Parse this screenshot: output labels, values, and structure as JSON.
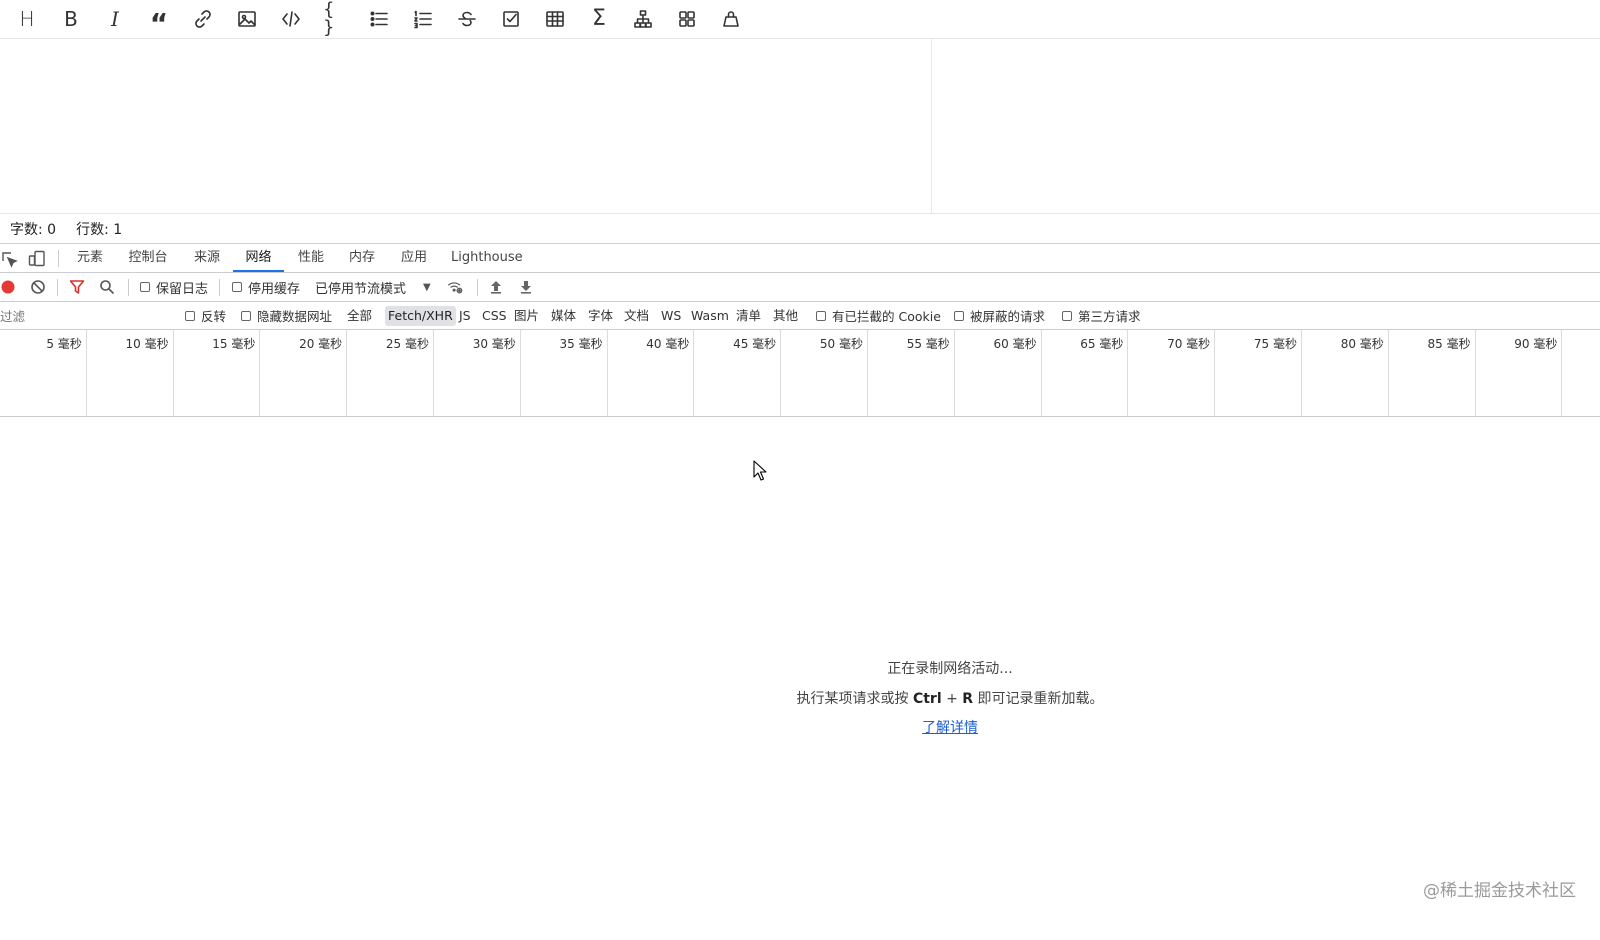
{
  "editor_toolbar": {
    "tools": [
      {
        "icon": "heading-icon",
        "glyph": "H"
      },
      {
        "icon": "bold-icon",
        "glyph": "B"
      },
      {
        "icon": "italic-icon",
        "glyph": "I"
      },
      {
        "icon": "quote-icon",
        "glyph": "“"
      },
      {
        "icon": "link-icon"
      },
      {
        "icon": "image-icon"
      },
      {
        "icon": "code-icon"
      },
      {
        "icon": "code-block-icon",
        "glyph": "{ }"
      },
      {
        "icon": "unordered-list-icon"
      },
      {
        "icon": "ordered-list-icon"
      },
      {
        "icon": "strikethrough-icon"
      },
      {
        "icon": "task-list-icon"
      },
      {
        "icon": "table-icon"
      },
      {
        "icon": "formula-icon",
        "glyph": "Σ"
      },
      {
        "icon": "mermaid-diagram-icon"
      },
      {
        "icon": "grid-icon"
      },
      {
        "icon": "clear-icon"
      }
    ]
  },
  "statusbar": {
    "word_count": "字数: 0",
    "line_count": "行数: 1"
  },
  "devtools": {
    "tabs": [
      "元素",
      "控制台",
      "来源",
      "网络",
      "性能",
      "内存",
      "应用",
      "Lighthouse"
    ],
    "active_tab": "网络"
  },
  "network_toolbar": {
    "preserve_log": "保留日志",
    "disable_cache": "停用缓存",
    "throttling": "已停用节流模式"
  },
  "filter_bar": {
    "placeholder": "过滤",
    "invert": "反转",
    "hide_data_urls": "隐藏数据网址",
    "types": [
      "全部",
      "Fetch/XHR",
      "JS",
      "CSS",
      "图片",
      "媒体",
      "字体",
      "文档",
      "WS",
      "Wasm",
      "清单",
      "其他"
    ],
    "active_type": "Fetch/XHR",
    "blocked_cookies": "有已拦截的 Cookie",
    "blocked_requests": "被屏蔽的请求",
    "third_party": "第三方请求"
  },
  "timeline": {
    "ticks": [
      "5 毫秒",
      "10 毫秒",
      "15 毫秒",
      "20 毫秒",
      "25 毫秒",
      "30 毫秒",
      "35 毫秒",
      "40 毫秒",
      "45 毫秒",
      "50 毫秒",
      "55 毫秒",
      "60 毫秒",
      "65 毫秒",
      "70 毫秒",
      "75 毫秒",
      "80 毫秒",
      "85 毫秒",
      "90 毫秒"
    ]
  },
  "empty_state": {
    "line1": "正在录制网络活动...",
    "line2_prefix": "执行某项请求或按 ",
    "key_ctrl": "Ctrl",
    "plus": " + ",
    "key_r": "R",
    "line2_suffix": " 即可记录重新加载。",
    "link": "了解详情"
  },
  "watermark": "@稀土掘金技术社区",
  "colors": {
    "record_red": "#e53935",
    "filter_red": "#d93025",
    "active_tab_blue": "#1a73e8",
    "link_blue": "#1a5fd4"
  }
}
